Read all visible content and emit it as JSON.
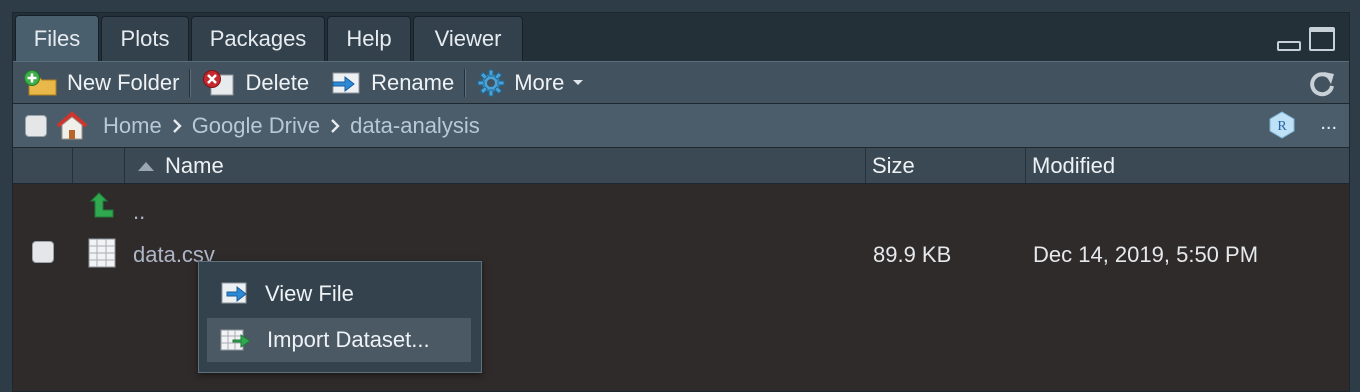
{
  "tabs": [
    {
      "label": "Files",
      "active": true
    },
    {
      "label": "Plots",
      "active": false
    },
    {
      "label": "Packages",
      "active": false
    },
    {
      "label": "Help",
      "active": false
    },
    {
      "label": "Viewer",
      "active": false
    }
  ],
  "toolbar": {
    "new_folder": "New Folder",
    "delete": "Delete",
    "rename": "Rename",
    "more": "More"
  },
  "breadcrumb": [
    "Home",
    "Google Drive",
    "data-analysis"
  ],
  "ellipsis": "...",
  "columns": {
    "name": "Name",
    "size": "Size",
    "modified": "Modified"
  },
  "files": [
    {
      "name": "..",
      "size": "",
      "modified": "",
      "icon": "parent-directory-icon"
    },
    {
      "name": "data.csv",
      "size": "89.9 KB",
      "modified": "Dec 14, 2019, 5:50 PM",
      "icon": "csv-file-icon"
    }
  ],
  "context_menu": [
    {
      "label": "View File",
      "icon": "view-file-icon",
      "highlighted": false
    },
    {
      "label": "Import Dataset...",
      "icon": "import-dataset-icon",
      "highlighted": true
    }
  ],
  "colors": {
    "accent": "#4a5f6e",
    "link": "#aeb6c6",
    "background": "#302b2b"
  }
}
